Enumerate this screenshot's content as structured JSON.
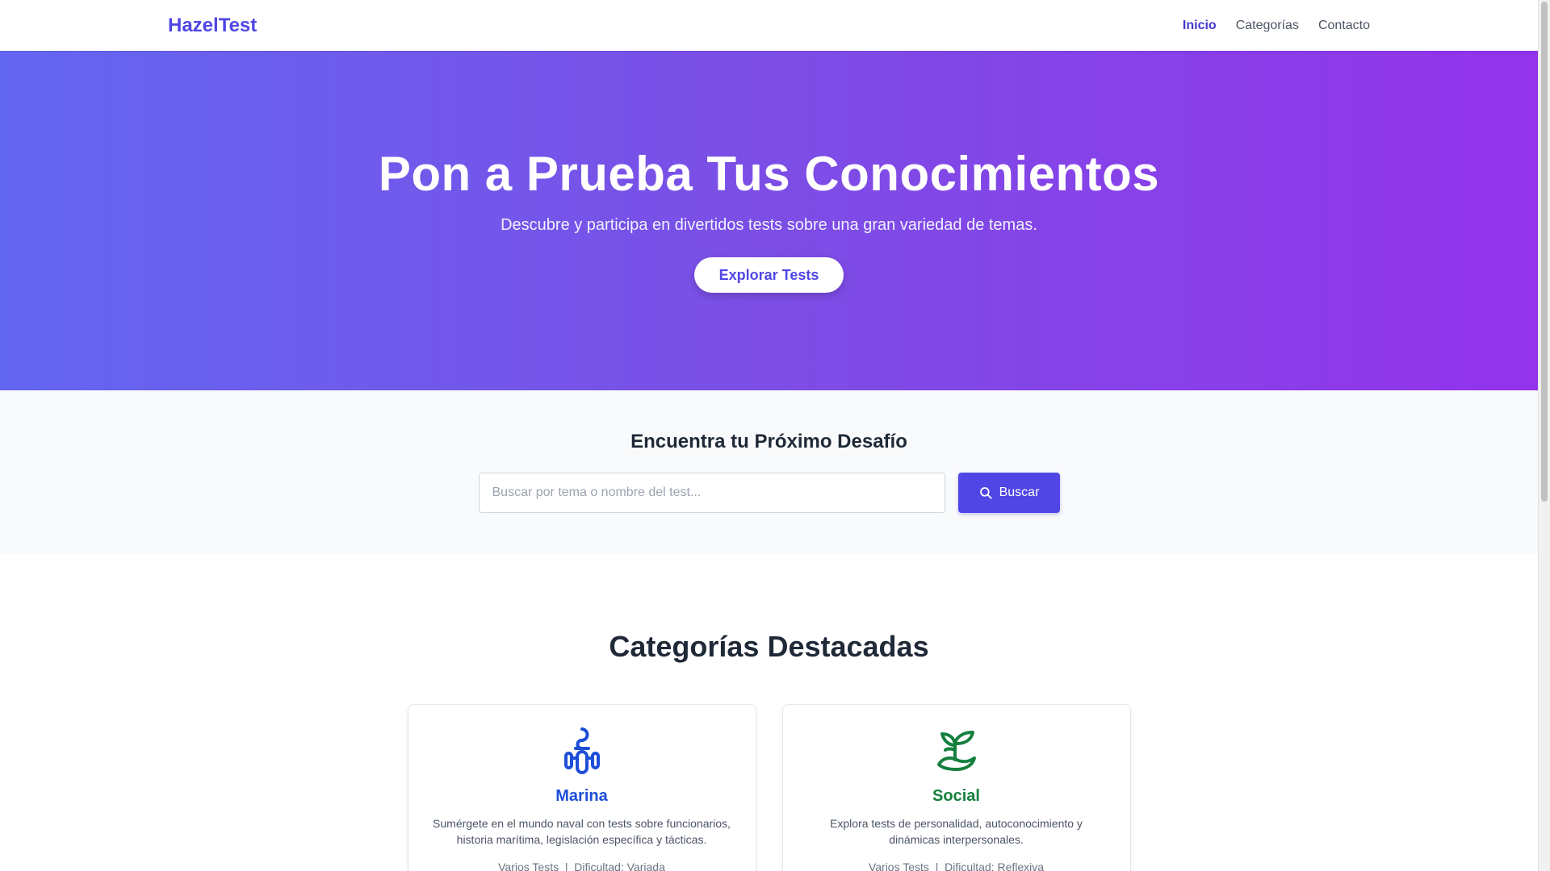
{
  "nav": {
    "brand": "HazelTest",
    "links": [
      "Inicio",
      "Categorías",
      "Contacto"
    ]
  },
  "hero": {
    "title": "Pon a Prueba Tus Conocimientos",
    "subtitle": "Descubre y participa en divertidos tests sobre una gran variedad de temas.",
    "cta": "Explorar Tests"
  },
  "search": {
    "title": "Encuentra tu Próximo Desafío",
    "placeholder": "Buscar por tema o nombre del test...",
    "button": "Buscar"
  },
  "categories": {
    "title": "Categorías Destacadas",
    "cards": [
      {
        "title": "Marina",
        "desc": "Sumérgete en el mundo naval con tests sobre funcionarios, historia marítima, legislación específica y tácticas.",
        "meta": "Varios Tests  |  Dificultad: Variada",
        "icon": "sailor-icon",
        "color": "#1d4ed8"
      },
      {
        "title": "Social",
        "desc": "Explora tests de personalidad, autoconocimiento y dinámicas interpersonales.",
        "meta": "Varios Tests  |  Dificultad: Reflexiva",
        "icon": "seedling-hand-icon",
        "color": "#15803d"
      }
    ]
  },
  "colors": {
    "brand": "#4f46e5",
    "hero_start": "#6366f1",
    "hero_end": "#9333ea"
  }
}
